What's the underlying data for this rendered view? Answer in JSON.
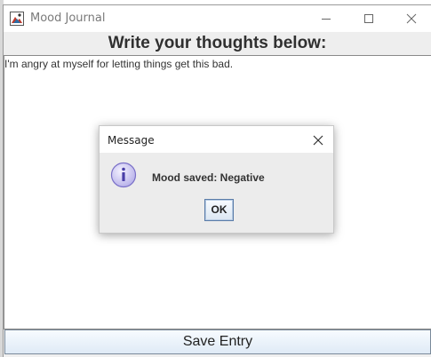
{
  "window": {
    "title": "Mood Journal",
    "heading": "Write your thoughts below:",
    "journal_text": "I'm angry at myself for letting things get this bad.",
    "save_label": "Save Entry"
  },
  "dialog": {
    "title": "Message",
    "message": "Mood saved: Negative",
    "ok_label": "OK"
  },
  "colors": {
    "accent": "#7a70c8",
    "button_border": "#5a7ca8"
  },
  "icons": [
    "app-icon",
    "minimize-icon",
    "maximize-icon",
    "close-icon",
    "info-icon"
  ]
}
